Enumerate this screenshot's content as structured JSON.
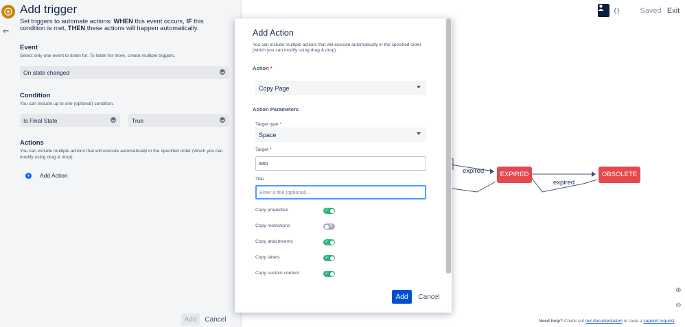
{
  "toolbar": {
    "saved_label": "Saved",
    "exit_label": "Exit"
  },
  "canvas": {
    "states": [
      "EXPIRED",
      "OBSOLETE"
    ],
    "transitions": [
      "expired",
      "expired"
    ]
  },
  "footer": {
    "need_help": "Need help?",
    "check_out": "Check out",
    "documentation_link": "our documentation",
    "or_raise": "or raise a",
    "support_link": "support request",
    "period": "."
  },
  "panel": {
    "title": "Add trigger",
    "description": {
      "set_triggers": "Set triggers to automate actions:",
      "when": "WHEN",
      "this_event": "this event occurs,",
      "if": "IF",
      "this_condition": "this condition",
      "is_met": "is met,",
      "then": "THEN",
      "these_actions": "these actions will happen automatically."
    },
    "event": {
      "title": "Event",
      "subtitle": "Select only one event to listen for. To listen for more, create multiple triggers.",
      "value": "On state changed"
    },
    "condition": {
      "title": "Condition",
      "subtitle": "You can include up to one (optional) condition.",
      "field_value": "Is Final State",
      "operand_value": "True"
    },
    "actions": {
      "title": "Actions",
      "subtitle": "You can include multiple actions that will execute automatically in the specified order (which you can modify using drag & drop).",
      "add_label": "Add Action"
    },
    "add_button": "Add",
    "cancel_button": "Cancel"
  },
  "modal": {
    "title": "Add Action",
    "subtitle": "You can include multiple actions that will execute automatically in the specified order (which you can modify using drag & drop).",
    "action_label": "Action",
    "action_value": "Copy Page",
    "params_label": "Action Parameters",
    "target_type_label": "Target type",
    "target_type_value": "Space",
    "target_label": "Target",
    "target_value": "IMD",
    "title_label": "Title",
    "title_placeholder": "Enter a title (optional)...",
    "toggles": [
      {
        "label": "Copy properties",
        "on": true
      },
      {
        "label": "Copy restrictions",
        "on": false
      },
      {
        "label": "Copy attachments",
        "on": true
      },
      {
        "label": "Copy labels",
        "on": true
      },
      {
        "label": "Copy custom content",
        "on": true
      }
    ],
    "add_button": "Add",
    "cancel_button": "Cancel"
  }
}
